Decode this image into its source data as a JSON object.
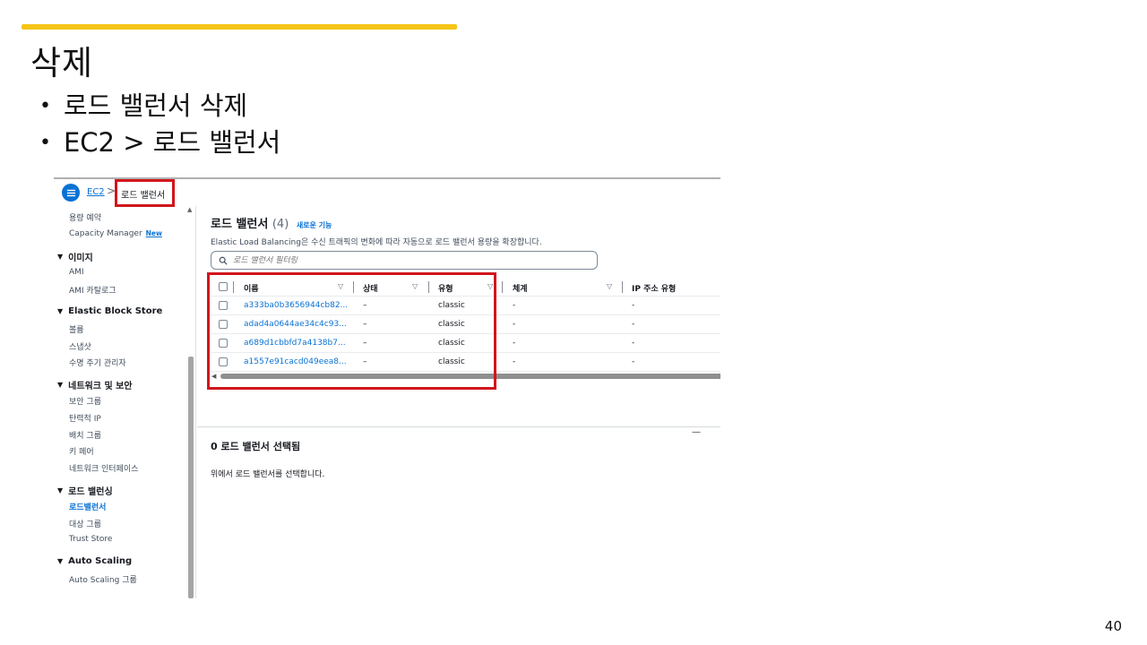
{
  "slide": {
    "title": "삭제",
    "bullets": [
      "로드 밸런서 삭제",
      "EC2 > 로드 밸런서"
    ],
    "page_number": "40",
    "accent_color": "#f5c518",
    "highlight_color": "#d0161b"
  },
  "breadcrumb": {
    "menu_icon": "hamburger-icon",
    "root": "EC2",
    "separator": ">",
    "current": "로드 밸런서"
  },
  "sidebar": {
    "items": [
      {
        "type": "item",
        "label": "용량 예약"
      },
      {
        "type": "item",
        "label": "Capacity Manager",
        "badge": "New"
      },
      {
        "type": "group",
        "label": "이미지"
      },
      {
        "type": "item",
        "label": "AMI"
      },
      {
        "type": "item",
        "label": "AMI 카탈로그"
      },
      {
        "type": "group",
        "label": "Elastic Block Store"
      },
      {
        "type": "item",
        "label": "볼륨"
      },
      {
        "type": "item",
        "label": "스냅샷"
      },
      {
        "type": "item",
        "label": "수명 주기 관리자"
      },
      {
        "type": "group",
        "label": "네트워크 및 보안"
      },
      {
        "type": "item",
        "label": "보안 그룹"
      },
      {
        "type": "item",
        "label": "탄력적 IP"
      },
      {
        "type": "item",
        "label": "배치 그룹"
      },
      {
        "type": "item",
        "label": "키 페어"
      },
      {
        "type": "item",
        "label": "네트워크 인터페이스"
      },
      {
        "type": "group",
        "label": "로드 밸런싱"
      },
      {
        "type": "item",
        "label": "로드밸런서",
        "active": true
      },
      {
        "type": "item",
        "label": "대상 그룹"
      },
      {
        "type": "item",
        "label": "Trust Store"
      },
      {
        "type": "group",
        "label": "Auto Scaling"
      },
      {
        "type": "item",
        "label": "Auto Scaling 그룹"
      }
    ]
  },
  "main": {
    "title": "로드 밸런서",
    "count": "(4)",
    "new_feature": "새로운 기능",
    "description": "Elastic Load Balancing은 수신 트래픽의 변화에 따라 자동으로 로드 밸런서 용량을 확장합니다.",
    "search_placeholder": "로드 밸런서 필터링",
    "columns": [
      "이름",
      "상태",
      "유형",
      "체계",
      "IP 주소 유형"
    ],
    "rows": [
      {
        "name": "a333ba0b3656944cb82...",
        "state": "–",
        "type": "classic",
        "scheme": "-",
        "ip": "-"
      },
      {
        "name": "adad4a0644ae34c4c93...",
        "state": "–",
        "type": "classic",
        "scheme": "-",
        "ip": "-"
      },
      {
        "name": "a689d1cbbfd7a4138b7...",
        "state": "–",
        "type": "classic",
        "scheme": "-",
        "ip": "-"
      },
      {
        "name": "a1557e91cacd049eea8...",
        "state": "–",
        "type": "classic",
        "scheme": "-",
        "ip": "-"
      }
    ]
  },
  "detail": {
    "collapse_symbol": "—",
    "title": "0 로드 밸런서 선택됨",
    "message": "위에서 로드 밸런서를 선택합니다."
  }
}
